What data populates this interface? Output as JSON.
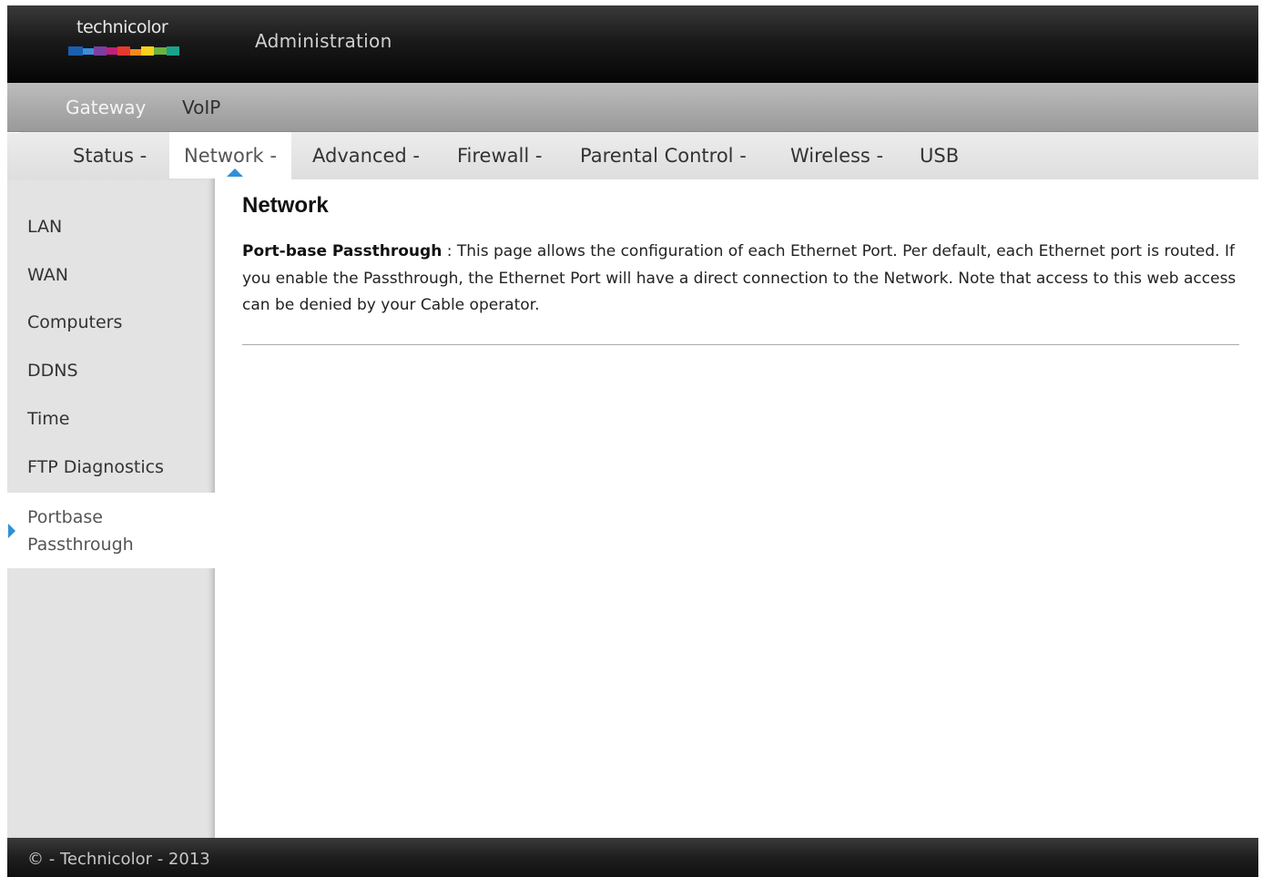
{
  "header": {
    "logo_text": "technicolor",
    "logo_colors": [
      "#1b5fb0",
      "#3b8fd8",
      "#7b3fa0",
      "#c2207a",
      "#e53a2f",
      "#f08a1e",
      "#f5d21c",
      "#6cb33f",
      "#1aa38c"
    ],
    "title": "Administration"
  },
  "topnav": {
    "items": [
      {
        "label": "Gateway",
        "active": true
      },
      {
        "label": "VoIP",
        "active": false
      }
    ]
  },
  "subnav": {
    "items": [
      {
        "label": "Status -",
        "active": false
      },
      {
        "label": "Network -",
        "active": true
      },
      {
        "label": "Advanced -",
        "active": false
      },
      {
        "label": "Firewall -",
        "active": false
      },
      {
        "label": "Parental Control -",
        "active": false
      },
      {
        "label": "Wireless -",
        "active": false
      },
      {
        "label": "USB",
        "active": false
      }
    ],
    "accent_color": "#2f8fd8"
  },
  "sidebar": {
    "items": [
      {
        "label": "LAN"
      },
      {
        "label": "WAN"
      },
      {
        "label": "Computers"
      },
      {
        "label": "DDNS"
      },
      {
        "label": "Time"
      },
      {
        "label": "FTP Diagnostics"
      }
    ],
    "active_item": {
      "line1": "Portbase",
      "line2": "Passthrough"
    }
  },
  "content": {
    "title": "Network",
    "section_label": "Port-base Passthrough",
    "separator": " : ",
    "description": "This page allows the configuration of each Ethernet Port. Per default, each Ethernet port is routed. If you enable the Passthrough, the Ethernet Port will have a direct connection to the Network. Note that access to this web access can be denied by your Cable operator."
  },
  "footer": {
    "text": "© - Technicolor - 2013"
  }
}
